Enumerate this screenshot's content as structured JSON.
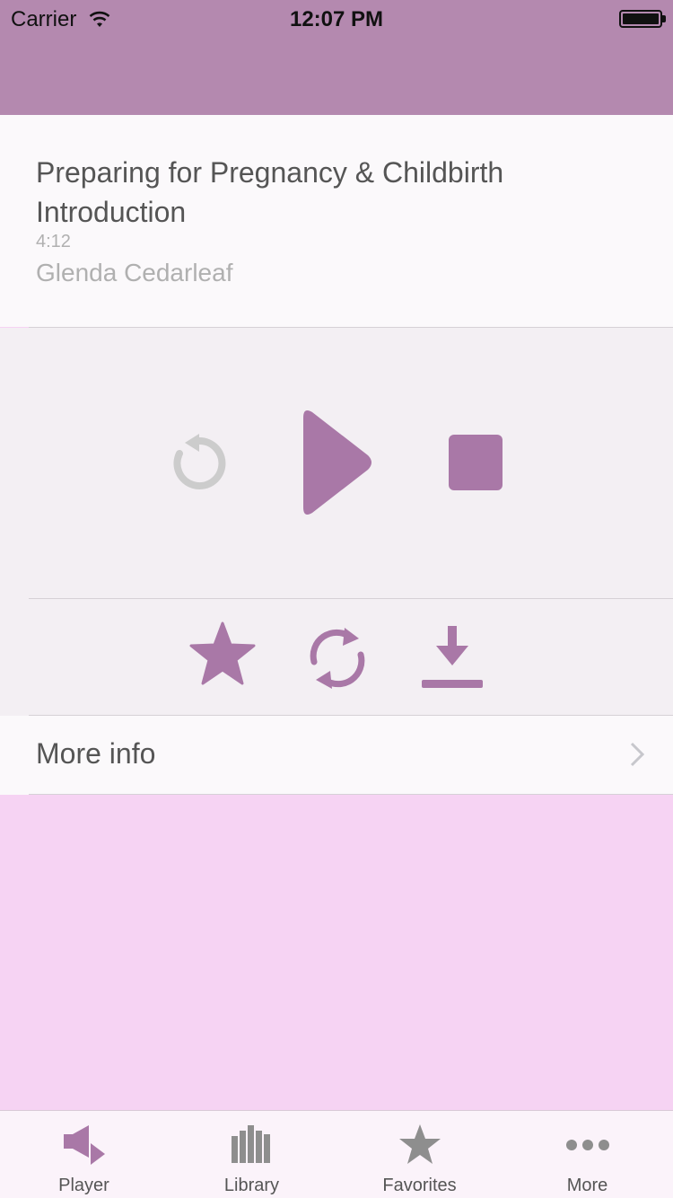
{
  "status_bar": {
    "carrier": "Carrier",
    "time": "12:07 PM"
  },
  "track": {
    "title": "Preparing for Pregnancy & Childbirth Introduction",
    "duration": "4:12",
    "author": "Glenda Cedarleaf"
  },
  "more_info": {
    "label": "More info"
  },
  "tabs": [
    {
      "label": "Player",
      "icon": "speaker-icon",
      "active": true
    },
    {
      "label": "Library",
      "icon": "library-icon",
      "active": false
    },
    {
      "label": "Favorites",
      "icon": "star-icon",
      "active": false
    },
    {
      "label": "More",
      "icon": "ellipsis-icon",
      "active": false
    }
  ],
  "colors": {
    "accent": "#a978a7",
    "nav_bar": "#b489af",
    "disabled": "#cccccc",
    "background": "#f6d3f3"
  }
}
